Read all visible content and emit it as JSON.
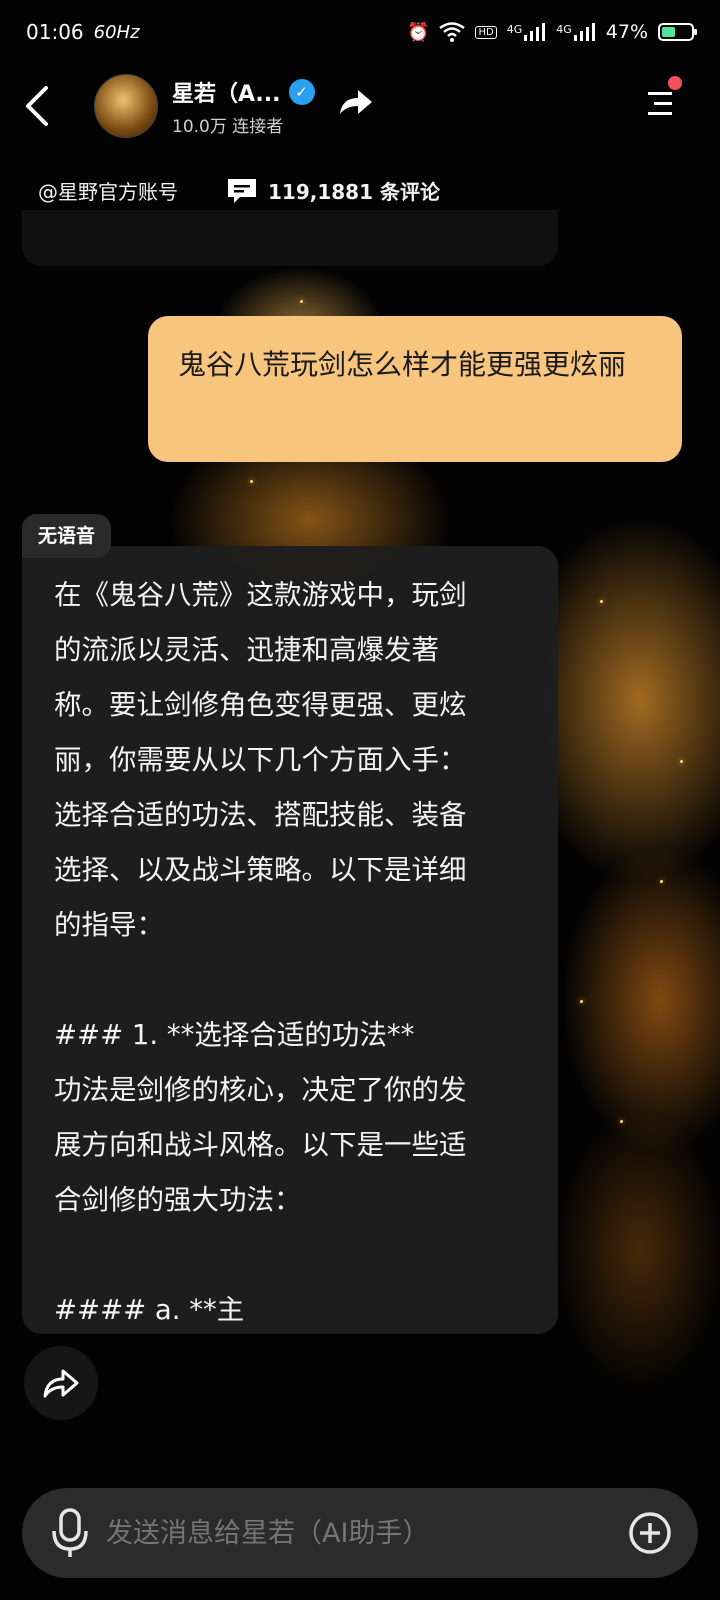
{
  "status_bar": {
    "time": "01:06",
    "refresh": "60Hz",
    "network1": "4G",
    "network2": "4G",
    "battery": "47%",
    "battery_level": 0.47
  },
  "header": {
    "name": "星若（A...",
    "connectors": "10.0万 连接者"
  },
  "subbar": {
    "account": "@星野官方账号",
    "comments": "119,1881 条评论"
  },
  "user_message": "鬼谷八荒玩剑怎么样才能更强更炫丽",
  "voice_tag": "无语音",
  "ai_message_lines": [
    "在《鬼谷八荒》这款游戏中，玩剑",
    "的流派以灵活、迅捷和高爆发著",
    "称。要让剑修角色变得更强、更炫",
    "丽，你需要从以下几个方面入手：",
    "选择合适的功法、搭配技能、装备",
    "选择、以及战斗策略。以下是详细",
    "的指导：",
    "",
    "### 1. **选择合适的功法**",
    "功法是剑修的核心，决定了你的发",
    "展方向和战斗风格。以下是一些适",
    "合剑修的强大功法：",
    "",
    "#### a. **主"
  ],
  "input": {
    "placeholder": "发送消息给星若（AI助手）"
  },
  "colors": {
    "user_bubble": "#f8c57e",
    "ai_bubble": "#1e1e1e",
    "verified": "#2aa0f0",
    "notification_dot": "#f0505a",
    "battery_fill": "#4fe3a0"
  }
}
